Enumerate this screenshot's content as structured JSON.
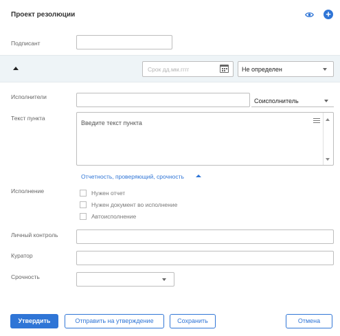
{
  "header": {
    "title": "Проект резолюции",
    "accent_color": "#2f75d6"
  },
  "signer": {
    "label": "Подписант",
    "value": ""
  },
  "item_bar": {
    "date_placeholder": "Срок дд.мм.гггг",
    "status_value": "Не определен"
  },
  "executors": {
    "label": "Исполнители",
    "value": "",
    "role_value": "Соисполнитель"
  },
  "item_text": {
    "label": "Текст пункта",
    "placeholder": "Введите текст пункта"
  },
  "details_link": "Отчетность, проверяющий, срочность",
  "execution": {
    "label": "Исполнение",
    "options": [
      {
        "label": "Нужен отчет",
        "checked": false
      },
      {
        "label": "Нужен документ во исполнение",
        "checked": false
      },
      {
        "label": "Автоисполнение",
        "checked": false
      }
    ]
  },
  "personal_control": {
    "label": "Личный контроль",
    "value": ""
  },
  "curator": {
    "label": "Куратор",
    "value": ""
  },
  "urgency": {
    "label": "Срочность",
    "value": ""
  },
  "footer": {
    "approve": "Утвердить",
    "send_for_approval": "Отправить на утверждение",
    "save": "Сохранить",
    "cancel": "Отмена"
  }
}
